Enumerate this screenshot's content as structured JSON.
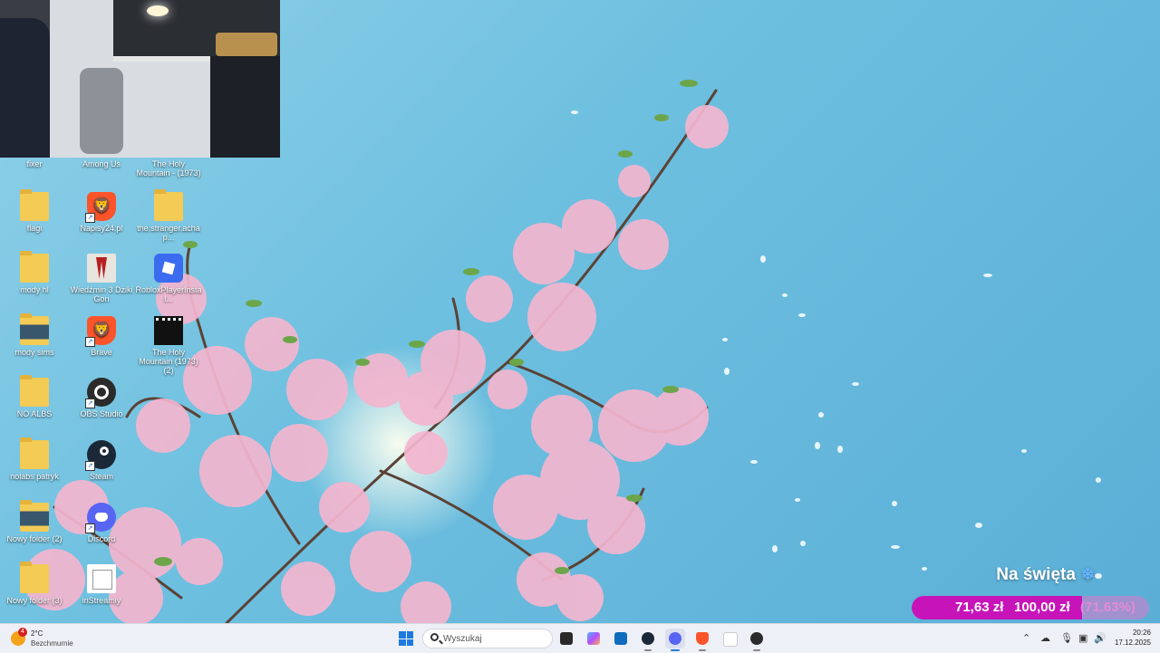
{
  "desktop": {
    "icons": [
      {
        "label": "fixer",
        "type": "folder"
      },
      {
        "label": "Among Us",
        "type": "app"
      },
      {
        "label": "The Holy Mountain - (1973)",
        "type": "app"
      },
      {
        "label": "flagi",
        "type": "folder"
      },
      {
        "label": "Napisy24.pl",
        "type": "brave"
      },
      {
        "label": "the.stranger.achap...",
        "type": "folder"
      },
      {
        "label": "mody hl",
        "type": "folder"
      },
      {
        "label": "Wiedźmin 3 Dziki Gon",
        "type": "witcher"
      },
      {
        "label": "RobloxPlayerInstal...",
        "type": "roblox"
      },
      {
        "label": "mody sims",
        "type": "folder"
      },
      {
        "label": "Brave",
        "type": "brave"
      },
      {
        "label": "The Holy Mountain (1973) (2)",
        "type": "film"
      },
      {
        "label": "NO ALBS",
        "type": "folder"
      },
      {
        "label": "OBS Studio",
        "type": "obs"
      },
      {
        "label": "nolabs patryk",
        "type": "folder"
      },
      {
        "label": "Steam",
        "type": "steam"
      },
      {
        "label": "Nowy folder (2)",
        "type": "folder"
      },
      {
        "label": "Discord",
        "type": "discord"
      },
      {
        "label": "Nowy folder (3)",
        "type": "folder"
      },
      {
        "label": "inStreamly",
        "type": "instreamly"
      }
    ]
  },
  "goal": {
    "title": "Na święta",
    "current": "71,63 zł",
    "target": "100,00 zł",
    "percent_label": "(71.63%)",
    "progress": 0.7163,
    "colors": {
      "fill": "#c614b9",
      "track": "#dc78c8"
    }
  },
  "taskbar": {
    "weather": {
      "badge": "4",
      "temp": "2°C",
      "desc": "Bezchmurnie"
    },
    "search_placeholder": "Wyszukaj",
    "apps": [
      {
        "name": "file-explorer-icon",
        "color": "#222"
      },
      {
        "name": "copilot-icon",
        "color": "#7b6cf0"
      },
      {
        "name": "store-icon",
        "color": "#0f6cbd"
      },
      {
        "name": "steam-icon",
        "color": "#1b2838"
      },
      {
        "name": "discord-icon",
        "color": "#5865f2"
      },
      {
        "name": "brave-icon",
        "color": "#fb542b"
      },
      {
        "name": "notepad-icon",
        "color": "#ffffff"
      },
      {
        "name": "obs-icon",
        "color": "#2b2b2b"
      }
    ],
    "clock": {
      "time": "20:26",
      "date": "17.12.2025"
    }
  }
}
